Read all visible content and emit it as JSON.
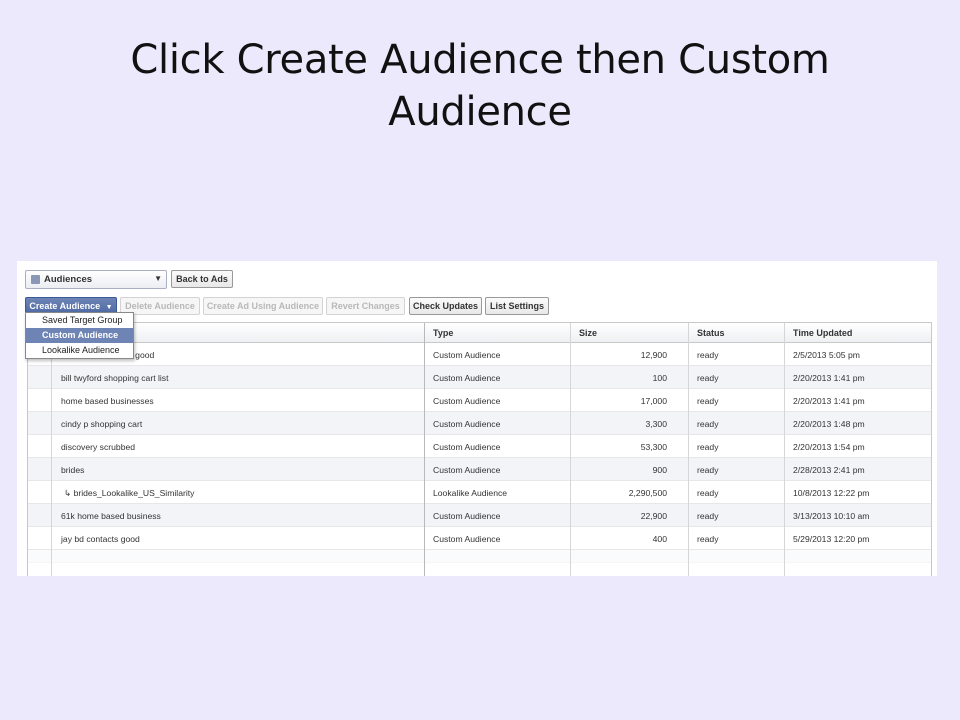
{
  "slide": {
    "title": "Click Create Audience then Custom Audience"
  },
  "toolbar": {
    "audience_select": "Audiences",
    "back_to_ads": "Back to Ads",
    "create_audience": "Create Audience",
    "delete_audience": "Delete Audience",
    "create_ad": "Create Ad Using Audience",
    "revert": "Revert Changes",
    "check_updates": "Check Updates",
    "list_settings": "List Settings"
  },
  "menu": {
    "items": [
      "Saved Target Group",
      "Custom Audience",
      "Lookalike Audience"
    ],
    "selected": "Custom Audience"
  },
  "table": {
    "columns": [
      "Type",
      "Size",
      "Status",
      "Time Updated"
    ],
    "rows": [
      {
        "name": "d good",
        "type": "Custom Audience",
        "size": "12,900",
        "status": "ready",
        "time": "2/5/2013 5:05 pm"
      },
      {
        "name": "bill twyford shopping cart list",
        "type": "Custom Audience",
        "size": "100",
        "status": "ready",
        "time": "2/20/2013 1:41 pm"
      },
      {
        "name": "home based businesses",
        "type": "Custom Audience",
        "size": "17,000",
        "status": "ready",
        "time": "2/20/2013 1:41 pm"
      },
      {
        "name": "cindy p shopping cart",
        "type": "Custom Audience",
        "size": "3,300",
        "status": "ready",
        "time": "2/20/2013 1:48 pm"
      },
      {
        "name": "discovery scrubbed",
        "type": "Custom Audience",
        "size": "53,300",
        "status": "ready",
        "time": "2/20/2013 1:54 pm"
      },
      {
        "name": "brides",
        "type": "Custom Audience",
        "size": "900",
        "status": "ready",
        "time": "2/28/2013 2:41 pm"
      },
      {
        "name": "↳ brides_Lookalike_US_Similarity",
        "type": "Lookalike Audience",
        "size": "2,290,500",
        "status": "ready",
        "time": "10/8/2013 12:22 pm"
      },
      {
        "name": "61k home based business",
        "type": "Custom Audience",
        "size": "22,900",
        "status": "ready",
        "time": "3/13/2013 10:10 am"
      },
      {
        "name": "jay bd contacts good",
        "type": "Custom Audience",
        "size": "400",
        "status": "ready",
        "time": "5/29/2013 12:20 pm"
      }
    ]
  },
  "colors": {
    "slide_bg": "#ebe9fb",
    "menu_highlight": "#6d84b4"
  }
}
